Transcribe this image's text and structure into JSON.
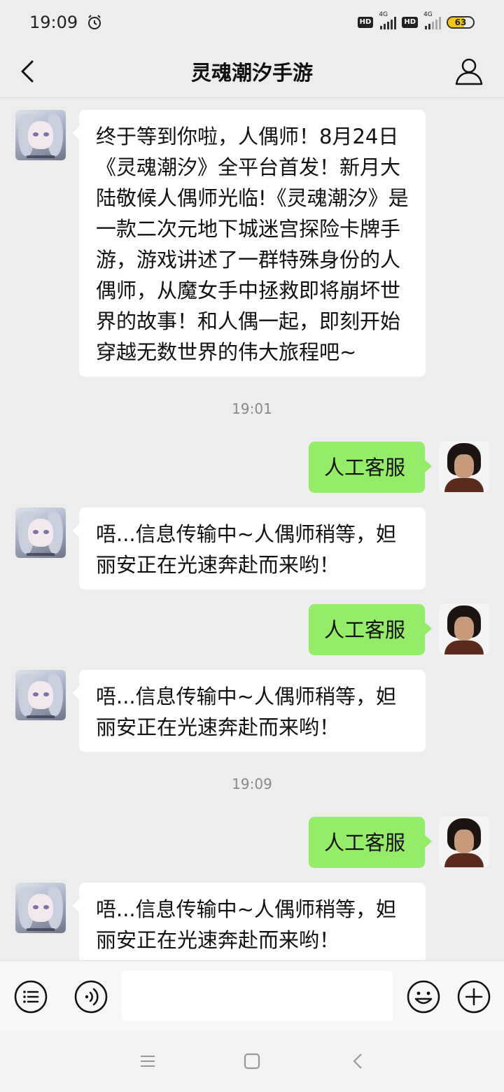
{
  "status_bar": {
    "time": "19:09",
    "network1_label": "4G",
    "network2_label": "4G",
    "hd_label": "HD",
    "battery_percent": "63"
  },
  "nav": {
    "title": "灵魂潮汐手游"
  },
  "messages": [
    {
      "side": "left",
      "text": "终于等到你啦，人偶师！8月24日《灵魂潮汐》全平台首发！新月大陆敬候人偶师光临!《灵魂潮汐》是一款二次元地下城迷宫探险卡牌手游，游戏讲述了一群特殊身份的人偶师，从魔女手中拯救即将崩坏世界的故事！和人偶一起，即刻开始穿越无数世界的伟大旅程吧~"
    },
    {
      "timestamp": "19:01"
    },
    {
      "side": "right",
      "text": "人工客服"
    },
    {
      "side": "left",
      "text": "唔...信息传输中~人偶师稍等，妲丽安正在光速奔赴而来哟！"
    },
    {
      "side": "right",
      "text": "人工客服"
    },
    {
      "side": "left",
      "text": "唔...信息传输中~人偶师稍等，妲丽安正在光速奔赴而来哟！"
    },
    {
      "timestamp": "19:09"
    },
    {
      "side": "right",
      "text": "人工客服"
    },
    {
      "side": "left",
      "text": "唔...信息传输中~人偶师稍等，妲丽安正在光速奔赴而来哟！"
    }
  ],
  "colors": {
    "background": "#ededed",
    "incoming_bubble": "#ffffff",
    "outgoing_bubble": "#95ec69",
    "battery_fill": "#f5c518"
  },
  "icons": {
    "back": "chevron-left-icon",
    "profile": "person-outline-icon",
    "menu": "list-circle-icon",
    "voice": "voice-circle-icon",
    "emoji": "smiley-icon",
    "add": "plus-circle-icon",
    "alarm": "alarm-clock-icon"
  }
}
